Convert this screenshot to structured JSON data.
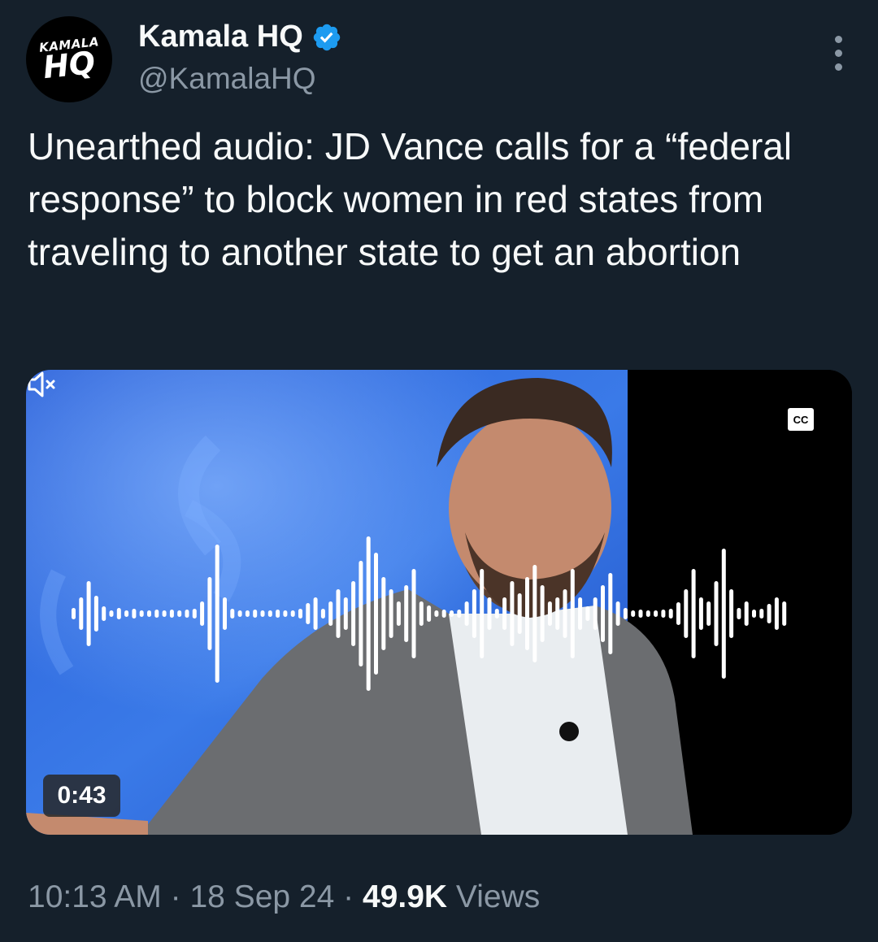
{
  "account": {
    "avatar_small_text": "KAMALA",
    "avatar_large_text": "HQ",
    "display_name": "Kamala HQ",
    "handle": "@KamalaHQ",
    "verified": true,
    "verified_color": "#1d9bf0"
  },
  "tweet": {
    "text": "Unearthed audio: JD Vance calls for a “federal response” to block women in red states from traveling to another state to get an abortion"
  },
  "video": {
    "duration": "0:43",
    "cc_label": "CC",
    "muted": true,
    "waveform_color": "#ffffff"
  },
  "meta": {
    "time": "10:13 AM",
    "separator": "·",
    "date": "18 Sep 24",
    "views_count": "49.9K",
    "views_label": "Views"
  },
  "theme": {
    "background": "#15202b",
    "primary_text": "#f7f9f9",
    "secondary_text": "#8b98a5"
  }
}
